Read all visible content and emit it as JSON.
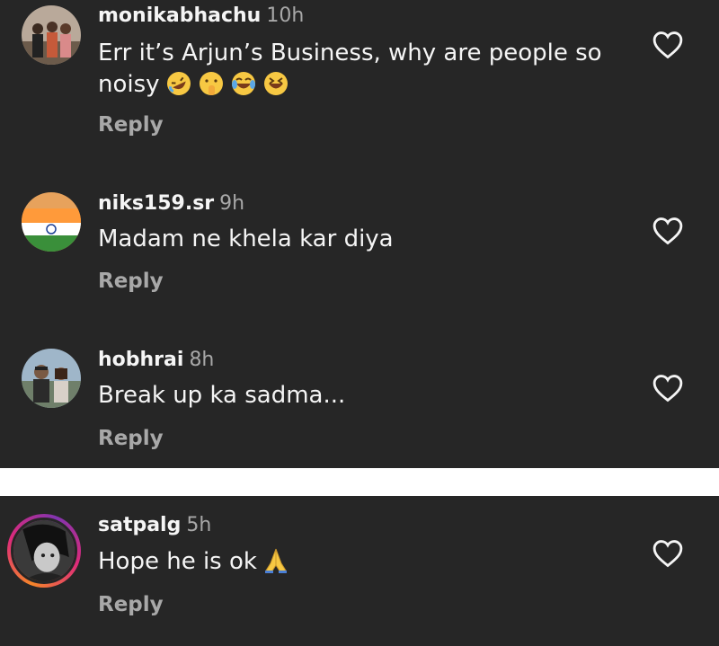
{
  "comments": [
    {
      "username": "monikabhachu",
      "time": "10h",
      "text": "Err it’s Arjun’s Business, why are people so noisy",
      "emojis": [
        "rolling-on-floor-laughing-emoji",
        "shushing-face-emoji",
        "tears-of-joy-emoji",
        "grinning-squinting-face-emoji"
      ],
      "reply_label": "Reply",
      "like_icon": "heart-outline-icon"
    },
    {
      "username": "niks159.sr",
      "time": "9h",
      "text": "Madam ne khela kar diya",
      "reply_label": "Reply",
      "like_icon": "heart-outline-icon"
    },
    {
      "username": "hobhrai",
      "time": "8h",
      "text": "Break up ka sadma...",
      "reply_label": "Reply",
      "like_icon": "heart-outline-icon"
    },
    {
      "username": "satpalg",
      "time": "5h",
      "text": "Hope he is ok",
      "emojis": [
        "folded-hands-emoji"
      ],
      "reply_label": "Reply",
      "like_icon": "heart-outline-icon"
    }
  ],
  "colors": {
    "background": "#262626",
    "primary_text": "#f5f5f5",
    "secondary_text": "#a8a8a8",
    "divider": "#ffffff"
  }
}
